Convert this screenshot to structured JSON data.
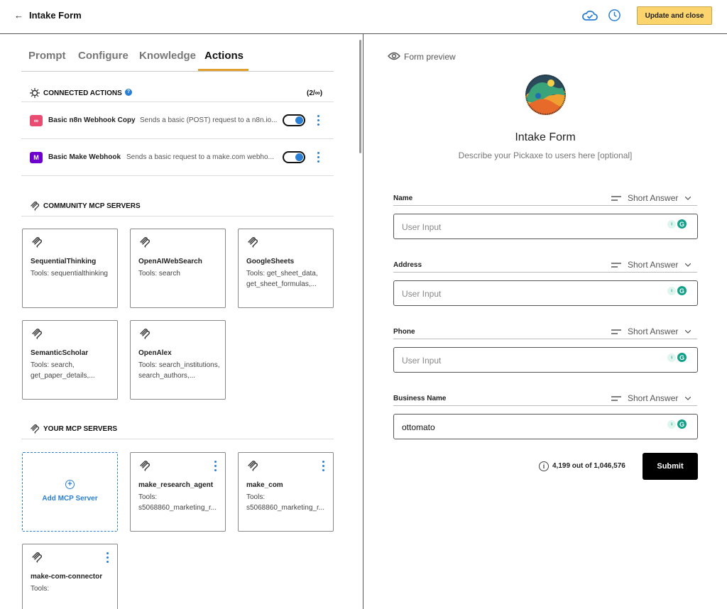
{
  "header": {
    "back_icon": "arrow-left-icon",
    "title": "Intake Form",
    "cloud_icon": "cloud-check-icon",
    "history_icon": "clock-icon",
    "update_label": "Update and close",
    "update_color": "#fbd46d"
  },
  "tabs": [
    {
      "label": "Prompt",
      "active": false
    },
    {
      "label": "Configure",
      "active": false
    },
    {
      "label": "Knowledge",
      "active": false
    },
    {
      "label": "Actions",
      "active": true
    }
  ],
  "connected_actions": {
    "title": "CONNECTED ACTIONS",
    "count": "(2/∞)",
    "items": [
      {
        "name": "Basic n8n Webhook Copy",
        "description": "Sends a basic (POST) request to a n8n.io...",
        "enabled": true,
        "logo_color": "#ea4b71"
      },
      {
        "name": "Basic Make Webhook",
        "description": "Sends a basic request to a make.com webho...",
        "enabled": true,
        "logo_color": "#6d00cc"
      }
    ]
  },
  "community_mcp": {
    "title": "COMMUNITY MCP SERVERS",
    "servers": [
      {
        "name": "SequentialThinking",
        "tools": "Tools: sequentialthinking"
      },
      {
        "name": "OpenAIWebSearch",
        "tools": "Tools: search"
      },
      {
        "name": "GoogleSheets",
        "tools": "Tools: get_sheet_data, get_sheet_formulas,..."
      },
      {
        "name": "SemanticScholar",
        "tools": "Tools: search, get_paper_details,..."
      },
      {
        "name": "OpenAlex",
        "tools": "Tools: search_institutions, search_authors,..."
      }
    ]
  },
  "your_mcp": {
    "title": "YOUR MCP SERVERS",
    "add_label": "Add MCP Server",
    "servers": [
      {
        "name": "make_research_agent",
        "tools": "Tools: s5068860_marketing_r..."
      },
      {
        "name": "make_com",
        "tools": "Tools: s5068860_marketing_r..."
      },
      {
        "name": "make-com-connector",
        "tools": "Tools:"
      }
    ]
  },
  "preview": {
    "label": "Form preview",
    "title": "Intake Form",
    "description": "Describe your Pickaxe to users here [optional]",
    "fields": [
      {
        "label": "Name",
        "type": "Short Answer",
        "value": "",
        "placeholder": "User Input"
      },
      {
        "label": "Address",
        "type": "Short Answer",
        "value": "",
        "placeholder": "User Input"
      },
      {
        "label": "Phone",
        "type": "Short Answer",
        "value": "",
        "placeholder": "User Input"
      },
      {
        "label": "Business Name",
        "type": "Short Answer",
        "value": "ottomato",
        "placeholder": "User Input"
      }
    ],
    "counter": "4,199 out of 1,046,576",
    "submit_label": "Submit"
  },
  "colors": {
    "accent": "#2a7fd4",
    "tab_underline": "#e0a030",
    "grammarly": "#13a088"
  }
}
